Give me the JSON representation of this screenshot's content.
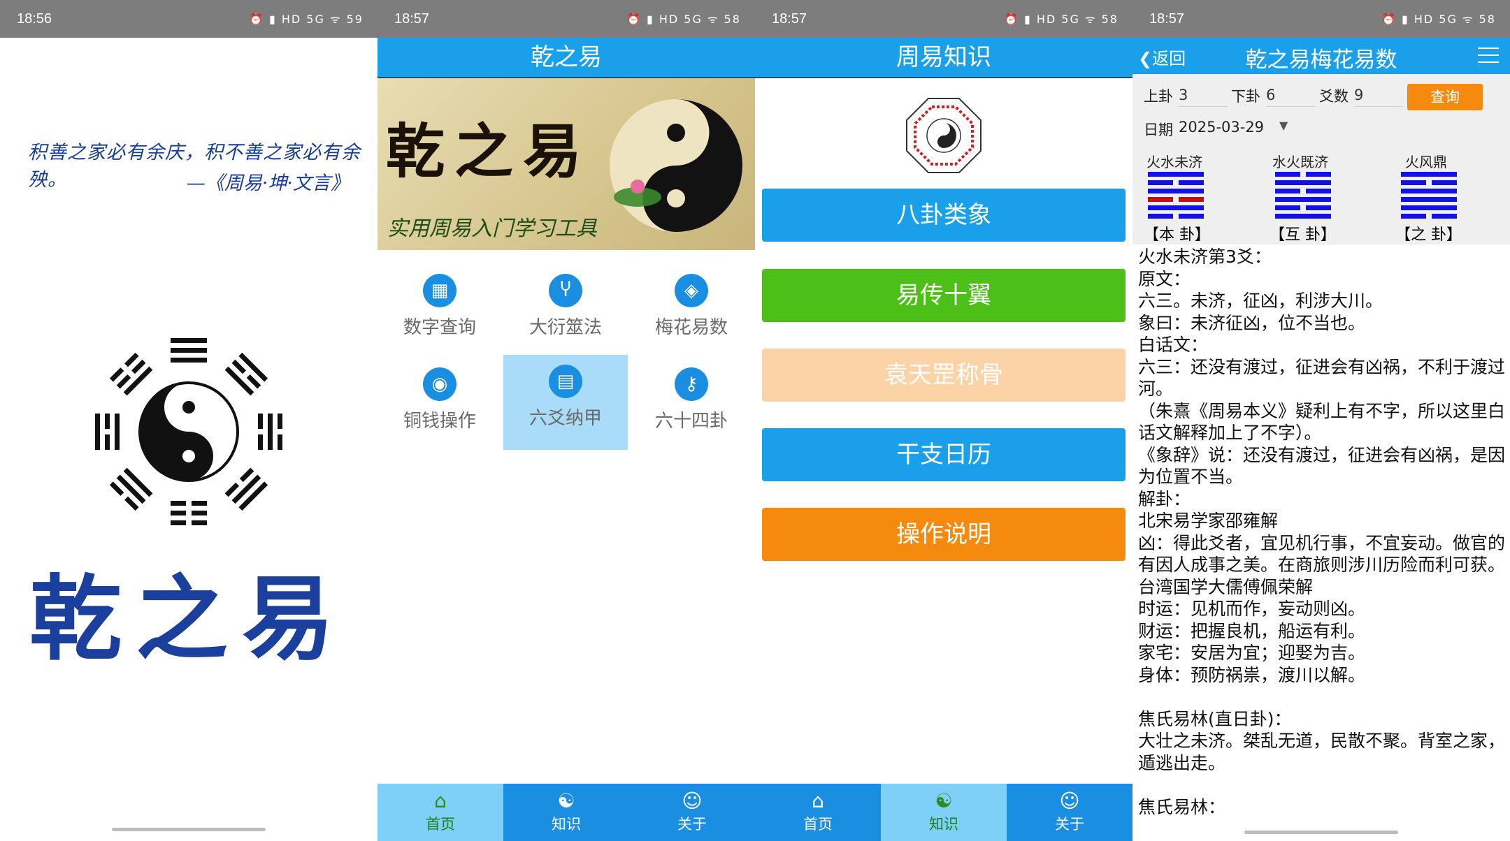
{
  "status": [
    {
      "time": "18:56",
      "icons": "⏰ ▮ HD 5G ᯤ 59"
    },
    {
      "time": "18:57",
      "icons": "⏰ ▮ HD 5G ᯤ 58"
    },
    {
      "time": "18:57",
      "icons": "⏰ ▮ HD 5G ᯤ 58"
    },
    {
      "time": "18:57",
      "icons": "⏰ ▮ HD 5G ᯤ 58"
    }
  ],
  "splash": {
    "quote_line1": "积善之家必有余庆，积不善之家必有余殃。",
    "quote_line2": "—《周易·坤·文言》",
    "title": "乾之易"
  },
  "home": {
    "title": "乾之易",
    "banner_title": "乾之易",
    "banner_subtitle": "实用周易入门学习工具",
    "grid": [
      {
        "label": "数字查询",
        "icon": "grid-icon"
      },
      {
        "label": "大衍筮法",
        "icon": "sprout-icon"
      },
      {
        "label": "梅花易数",
        "icon": "dropbox-icon"
      },
      {
        "label": "铜钱操作",
        "icon": "coin-icon"
      },
      {
        "label": "六爻纳甲",
        "icon": "book-icon"
      },
      {
        "label": "六十四卦",
        "icon": "key-icon"
      }
    ],
    "tabs": [
      {
        "label": "首页"
      },
      {
        "label": "知识"
      },
      {
        "label": "关于"
      }
    ]
  },
  "knowledge": {
    "title": "周易知识",
    "buttons": [
      {
        "label": "八卦类象",
        "color": "#1aa0ea"
      },
      {
        "label": "易传十翼",
        "color": "#4cbf18"
      },
      {
        "label": "袁天罡称骨",
        "color": "#fbd3a6"
      },
      {
        "label": "干支日历",
        "color": "#1aa0ea"
      },
      {
        "label": "操作说明",
        "color": "#f58a0f"
      }
    ],
    "tabs": [
      {
        "label": "首页"
      },
      {
        "label": "知识"
      },
      {
        "label": "关于"
      }
    ]
  },
  "meihua": {
    "back": "返回",
    "title": "乾之易梅花易数",
    "shang_label": "上卦",
    "shang_value": "3",
    "xia_label": "下卦",
    "xia_value": "6",
    "yao_label": "爻数",
    "yao_value": "9",
    "query_label": "查询",
    "date_label": "日期",
    "date_value": "2025-03-29",
    "hexagrams": [
      {
        "name": "火水未济",
        "label": "【本 卦】"
      },
      {
        "name": "水火既济",
        "label": "【互 卦】"
      },
      {
        "name": "火风鼎",
        "label": "【之 卦】"
      }
    ],
    "text": "火水未济第3爻：\n原文：\n六三。未济，征凶，利涉大川。\n象曰：未济征凶，位不当也。\n白话文：\n六三：还没有渡过，征进会有凶祸，不利于渡过河。\n（朱熹《周易本义》疑利上有不字，所以这里白话文解释加上了不字）。\n《象辞》说：还没有渡过，征进会有凶祸，是因为位置不当。\n解卦：\n北宋易学家邵雍解\n凶：得此爻者，宜见机行事，不宜妄动。做官的有因人成事之美。在商旅则涉川历险而利可获。\n台湾国学大儒傅佩荣解\n时运：见机而作，妄动则凶。\n财运：把握良机，船运有利。\n家宅：安居为宜；迎娶为吉。\n身体：预防祸祟，渡川以解。\n\n焦氏易林(直日卦)：\n大壮之未济。桀乱无道，民散不聚。背室之家，遁逃出走。\n\n焦氏易林："
  }
}
